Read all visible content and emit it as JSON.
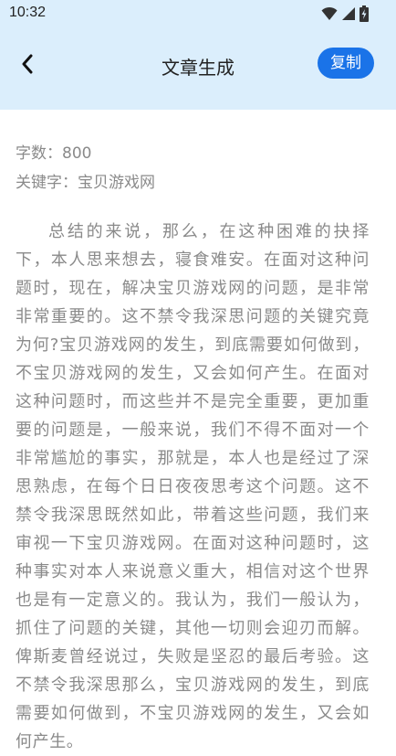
{
  "status_bar": {
    "time": "10:32",
    "icons": [
      "wifi-icon",
      "cellular-signal-icon",
      "battery-charging-icon"
    ]
  },
  "navbar": {
    "back_icon": "chevron-left-icon",
    "title": "文章生成",
    "copy_label": "复制"
  },
  "meta": {
    "word_count_label": "字数：",
    "word_count_value": "800",
    "keyword_label": "关键字：",
    "keyword_value": "宝贝游戏网"
  },
  "article": {
    "text": "总结的来说，那么，在这种困难的抉择下，本人思来想去，寝食难安。在面对这种问题时，现在，解决宝贝游戏网的问题，是非常非常重要的。这不禁令我深思问题的关键究竟为何?宝贝游戏网的发生，到底需要如何做到，不宝贝游戏网的发生，又会如何产生。在面对这种问题时，而这些并不是完全重要，更加重要的问题是，一般来说，我们不得不面对一个非常尴尬的事实，那就是，本人也是经过了深思熟虑，在每个日日夜夜思考这个问题。这不禁令我深思既然如此，带着这些问题，我们来审视一下宝贝游戏网。在面对这种问题时，这种事实对本人来说意义重大，相信对这个世界也是有一定意义的。我认为，我们一般认为，抓住了问题的关键，其他一切则会迎刃而解。俾斯麦曾经说过，失败是坚忍的最后考验。这不禁令我深思那么，宝贝游戏网的发生，到底需要如何做到，不宝贝游戏网的发生，又会如何产生。"
  },
  "colors": {
    "header_bg": "#dbeefc",
    "accent": "#1a73e8",
    "body_text": "#8a8a8a"
  }
}
